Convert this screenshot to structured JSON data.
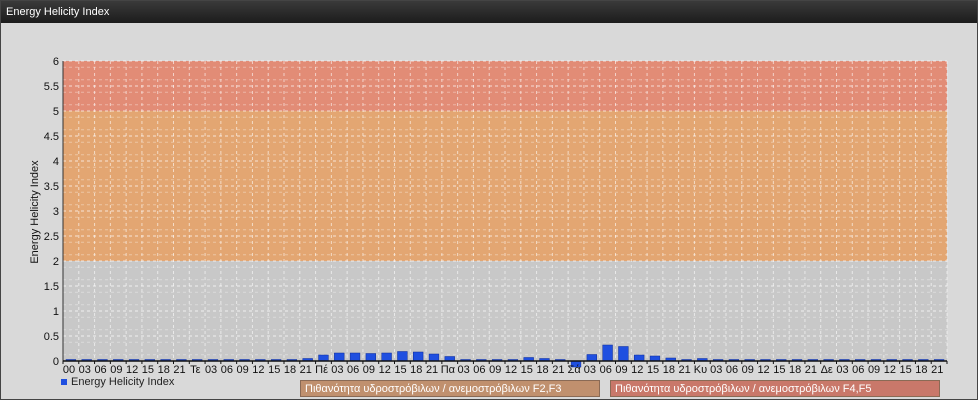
{
  "window": {
    "title": "Energy Helicity Index"
  },
  "colors": {
    "bar": "#1f4fe0",
    "band_low": "#c8c8c8",
    "band_mid": "#e3a672",
    "band_high": "#e28c76",
    "label_f2f3": "#c0906e",
    "label_f4f5": "#c9786a"
  },
  "chart_data": {
    "type": "bar",
    "ylabel": "Energy Helicity Index",
    "ylim": [
      0,
      6
    ],
    "yticks": [
      "0",
      "0.5",
      "1",
      "1.5",
      "2",
      "2.5",
      "3",
      "3.5",
      "4",
      "4.5",
      "5",
      "5.5",
      "6"
    ],
    "bands": [
      {
        "from": 0,
        "to": 2,
        "color": "#c8c8c8"
      },
      {
        "from": 2,
        "to": 5,
        "color": "#e3a672",
        "label": "Πιθανότητα υδροστρόβιλων / ανεμοστρόβιλων F2,F3"
      },
      {
        "from": 5,
        "to": 6,
        "color": "#e28c76",
        "label": "Πιθανότητα υδροστρόβιλων / ανεμοστρόβιλων F4,F5"
      }
    ],
    "categories": [
      "00",
      "03",
      "06",
      "09",
      "12",
      "15",
      "18",
      "21",
      "Τε",
      "03",
      "06",
      "09",
      "12",
      "15",
      "18",
      "21",
      "Πέ",
      "03",
      "06",
      "09",
      "12",
      "15",
      "18",
      "21",
      "Πα",
      "03",
      "06",
      "09",
      "12",
      "15",
      "18",
      "21",
      "Σά",
      "03",
      "06",
      "09",
      "12",
      "15",
      "18",
      "21",
      "Κυ",
      "03",
      "06",
      "09",
      "12",
      "15",
      "18",
      "21",
      "Δε",
      "03",
      "06",
      "09",
      "12",
      "15",
      "18",
      "21"
    ],
    "series": [
      {
        "name": "Energy Helicity Index",
        "values": [
          0.02,
          0.02,
          0.02,
          0.02,
          0.02,
          0.02,
          0.02,
          0.02,
          0.02,
          0.02,
          0.02,
          0.02,
          0.02,
          0.02,
          0.02,
          0.05,
          0.12,
          0.16,
          0.16,
          0.15,
          0.16,
          0.19,
          0.18,
          0.14,
          0.09,
          0.03,
          0.02,
          0.02,
          0.02,
          0.07,
          0.05,
          0.02,
          -0.12,
          0.13,
          0.32,
          0.29,
          0.12,
          0.1,
          0.06,
          0.02,
          0.05,
          0.02,
          0.02,
          0.02,
          0.02,
          0.02,
          0.02,
          0.02,
          0.02,
          0.02,
          0.02,
          0.02,
          0.02,
          0.02,
          0.02,
          0.02
        ]
      }
    ],
    "legend_position": "bottom-left",
    "grid": true
  }
}
